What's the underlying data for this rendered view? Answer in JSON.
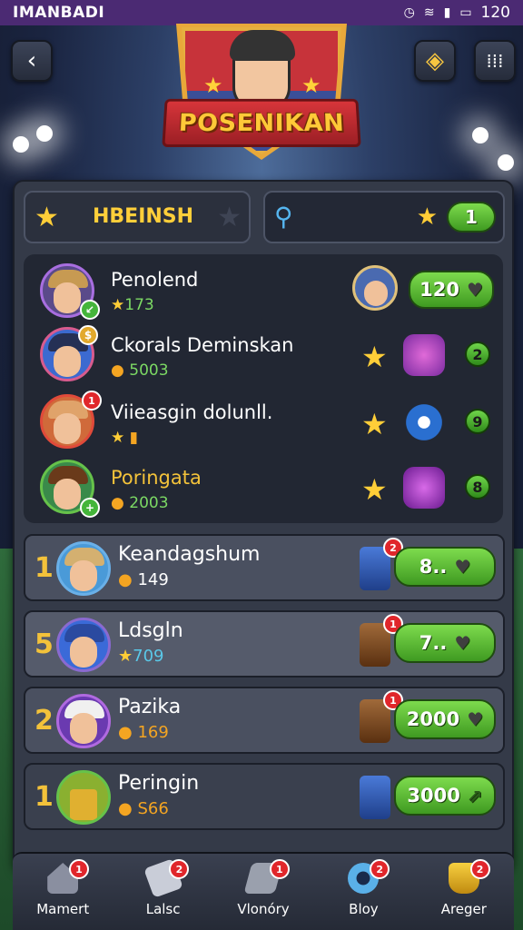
{
  "status_bar": {
    "carrier": "IMANBADI",
    "time": "120"
  },
  "header": {
    "back_icon": "chevron-left-icon",
    "title": "POSENIKAN",
    "shop_icon": "coin-bag-icon",
    "menu_icon": "grid-menu-icon"
  },
  "tabs": {
    "left_label": "HBEINSH",
    "right_value": "1"
  },
  "friends": [
    {
      "name": "Penolend",
      "score": "173",
      "value": "120"
    },
    {
      "name": "Ckorals Deminskan",
      "score": "5003"
    },
    {
      "name": "Viieasgin dolunll.",
      "count": "9"
    },
    {
      "name": "Poringata",
      "score": "2003",
      "count": "8"
    }
  ],
  "friend_counts": {
    "row2": "2"
  },
  "leaderboard": [
    {
      "rank": "1",
      "name": "Keandagshum",
      "score": "149",
      "reward": "8..",
      "badge": "2"
    },
    {
      "rank": "5",
      "name": "Ldsgln",
      "score": "709",
      "reward": "7..",
      "badge": "1"
    },
    {
      "rank": "2",
      "name": "Pazika",
      "score": "169",
      "reward": "2000",
      "badge": "1"
    },
    {
      "rank": "1",
      "name": "Peringin",
      "score": "S66",
      "reward": "3000",
      "badge": ""
    }
  ],
  "nav": [
    {
      "label": "Mamert",
      "icon": "home-icon",
      "badge": "1"
    },
    {
      "label": "Lalsc",
      "icon": "cards-icon",
      "badge": "2"
    },
    {
      "label": "Vlonóry",
      "icon": "pen-icon",
      "badge": "1"
    },
    {
      "label": "Bloy",
      "icon": "camera-icon",
      "badge": "2"
    },
    {
      "label": "Areger",
      "icon": "trophy-icon",
      "badge": "2"
    }
  ]
}
